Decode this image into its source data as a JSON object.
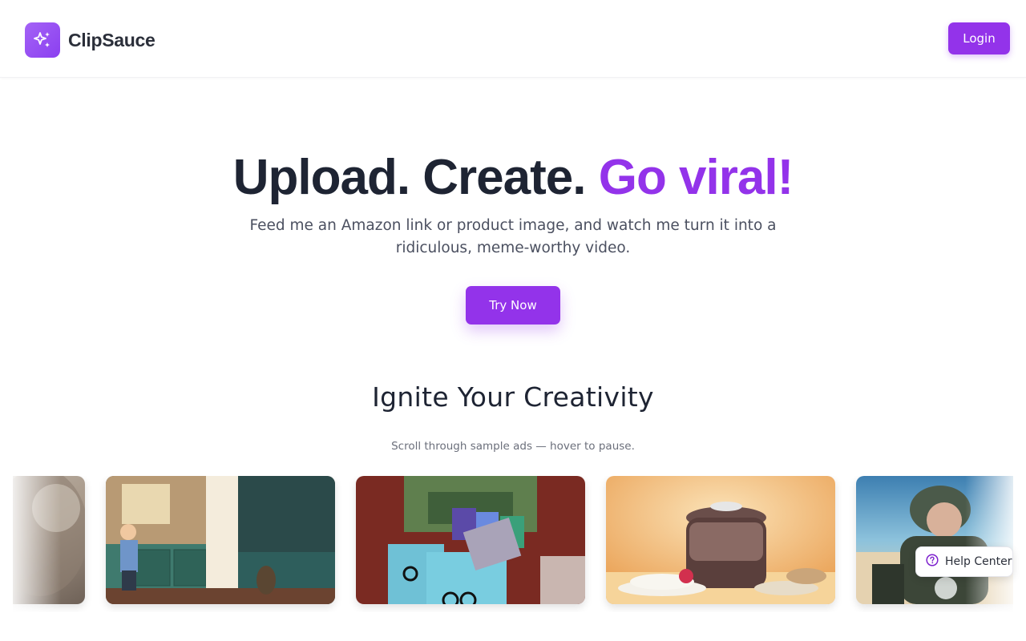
{
  "header": {
    "brand_name": "ClipSauce",
    "login_label": "Login"
  },
  "hero": {
    "title_part1": "Upload. Create. ",
    "title_accent": "Go viral!",
    "subtitle": "Feed me an Amazon link or product image, and watch me turn it into a ridiculous, meme-worthy video.",
    "cta_label": "Try Now"
  },
  "gallery": {
    "title": "Ignite Your Creativity",
    "note": "Scroll through sample ads — hover to pause."
  },
  "help": {
    "label": "Help Center"
  },
  "colors": {
    "accent": "#9333ea",
    "heading": "#1e2433",
    "body_text": "#4b5060"
  },
  "icons": [
    "sparkles-icon",
    "question-circle-icon"
  ]
}
